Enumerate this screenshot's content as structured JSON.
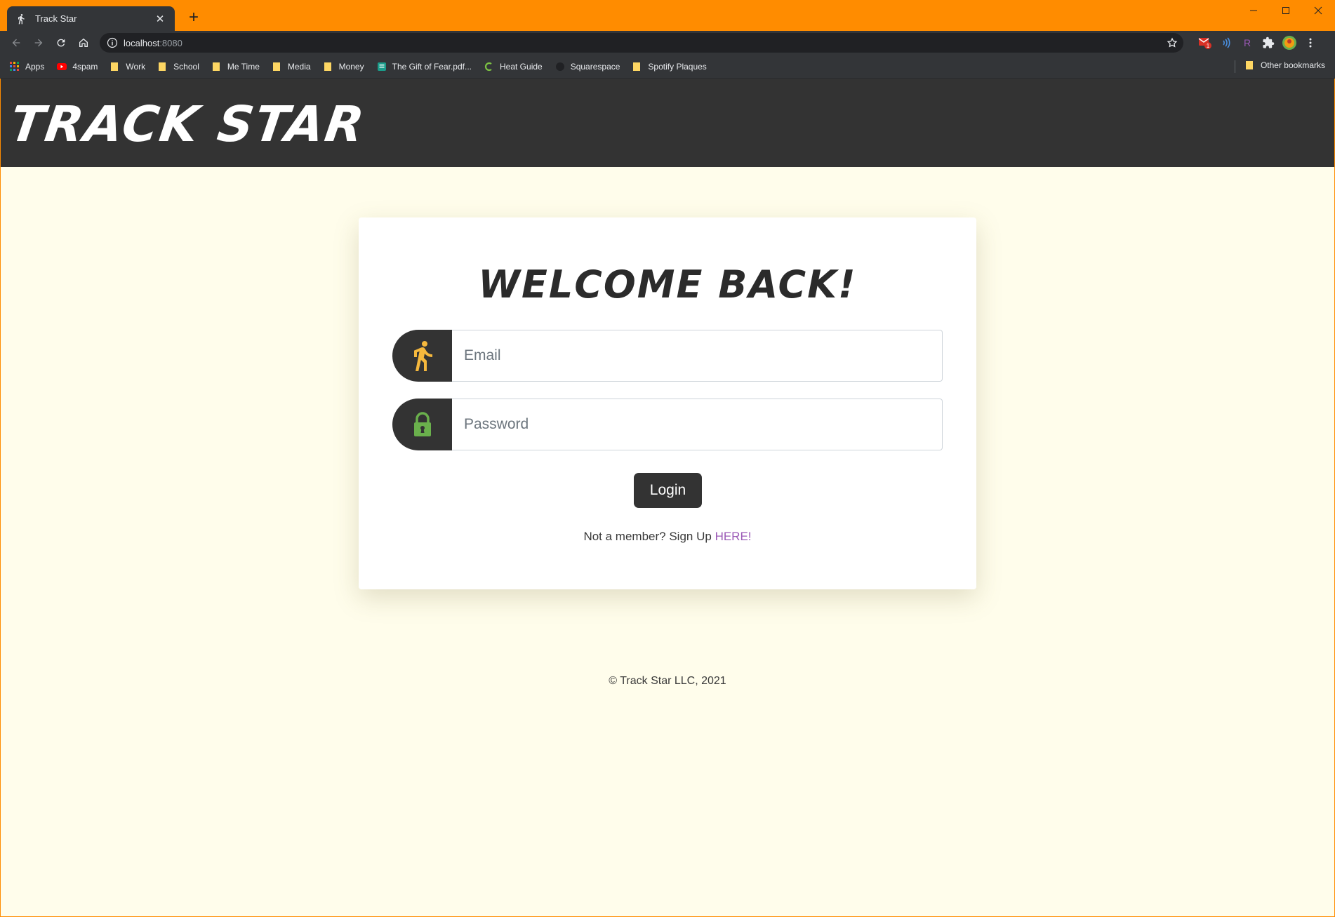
{
  "browser": {
    "tab": {
      "title": "Track Star",
      "close_glyph": "✕"
    },
    "new_tab_glyph": "+",
    "address": {
      "host": "localhost",
      "port": ":8080"
    },
    "window_controls": {
      "minimize": "—",
      "maximize": "☐",
      "close": "✕"
    },
    "bookmarks": [
      {
        "label": "Apps",
        "icon": "apps-grid-icon"
      },
      {
        "label": "4spam",
        "icon": "youtube-icon"
      },
      {
        "label": "Work",
        "icon": "folder-icon"
      },
      {
        "label": "School",
        "icon": "folder-icon"
      },
      {
        "label": "Me Time",
        "icon": "folder-icon"
      },
      {
        "label": "Media",
        "icon": "folder-icon"
      },
      {
        "label": "Money",
        "icon": "folder-icon"
      },
      {
        "label": "The Gift of Fear.pdf...",
        "icon": "document-icon"
      },
      {
        "label": "Heat Guide",
        "icon": "heat-guide-icon"
      },
      {
        "label": "Squarespace",
        "icon": "squarespace-icon"
      },
      {
        "label": "Spotify Plaques",
        "icon": "folder-icon"
      }
    ],
    "other_bookmarks": "Other bookmarks",
    "extension_badge": "1"
  },
  "site": {
    "logo": "TRACK STAR",
    "welcome": "WELCOME BACK!",
    "email": {
      "placeholder": "Email",
      "value": ""
    },
    "password": {
      "placeholder": "Password",
      "value": ""
    },
    "login_label": "Login",
    "signup_prompt": "Not a member? Sign Up",
    "signup_link": "HERE!",
    "footer": "© Track Star LLC, 2021"
  },
  "colors": {
    "chrome_frame": "#ff8c00",
    "toolbar": "#333538",
    "page_bg": "#fffdeb",
    "header_bg": "#333333",
    "runner_icon": "#f5b83d",
    "lock_icon": "#6ab04c",
    "link": "#9b59b6"
  }
}
